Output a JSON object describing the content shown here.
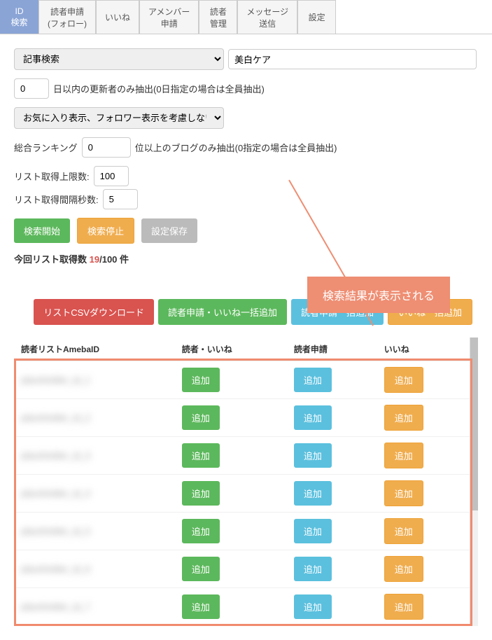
{
  "tabs": [
    {
      "label": "ID\n検索",
      "active": true
    },
    {
      "label": "読者申請\n(フォロー)"
    },
    {
      "label": "いいね"
    },
    {
      "label": "アメンバー\n申請"
    },
    {
      "label": "読者\n管理"
    },
    {
      "label": "メッセージ\n送信"
    },
    {
      "label": "設定"
    }
  ],
  "search": {
    "type_option": "記事検索",
    "keyword": "美白ケア"
  },
  "days": {
    "value": "0",
    "label": "日以内の更新者のみ抽出(0日指定の場合は全員抽出)"
  },
  "favorite_option": "お気に入り表示、フォロワー表示を考慮しない",
  "ranking": {
    "prefix": "総合ランキング",
    "value": "0",
    "suffix": "位以上のブログのみ抽出(0指定の場合は全員抽出)"
  },
  "limit": {
    "label": "リスト取得上限数:",
    "value": "100"
  },
  "interval": {
    "label": "リスト取得間隔秒数:",
    "value": "5"
  },
  "buttons": {
    "start": "検索開始",
    "stop": "検索停止",
    "save": "設定保存",
    "csv": "リストCSVダウンロード",
    "bulk_reader_like": "読者申請・いいね一括追加",
    "bulk_reader": "読者申請一括追加",
    "bulk_like": "いいね一括追加",
    "add": "追加"
  },
  "status": {
    "prefix": "今回リスト取得数 ",
    "current": "19",
    "sep": "/",
    "total": "100",
    "unit": " 件"
  },
  "table": {
    "headers": [
      "読者リストAmebaID",
      "読者・いいね",
      "読者申請",
      "いいね"
    ],
    "rows": [
      {
        "id": "placeholder_id_1"
      },
      {
        "id": "placeholder_id_2"
      },
      {
        "id": "placeholder_id_3"
      },
      {
        "id": "placeholder_id_4"
      },
      {
        "id": "placeholder_id_5"
      },
      {
        "id": "placeholder_id_6"
      },
      {
        "id": "placeholder_id_7"
      }
    ]
  },
  "callout": "検索結果が表示される"
}
